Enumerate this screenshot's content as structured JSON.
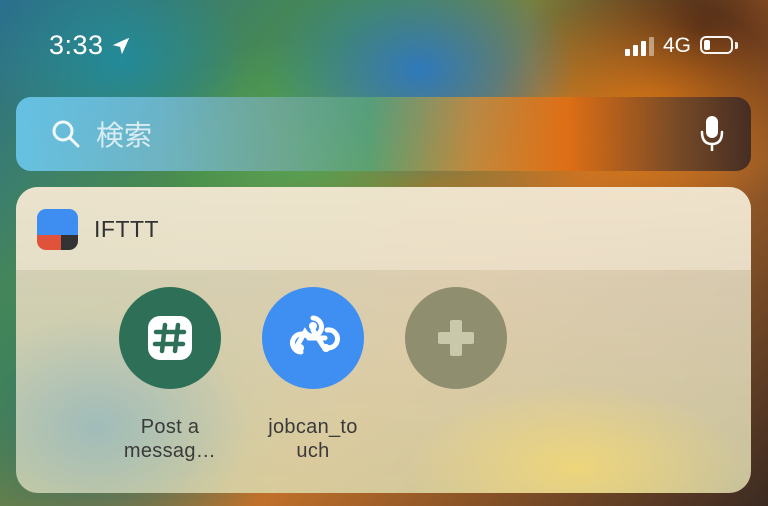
{
  "status": {
    "time": "3:33",
    "network": "4G"
  },
  "search": {
    "placeholder": "検索"
  },
  "widget": {
    "app_name": "IFTTT",
    "actions": [
      {
        "label_line1": "Post a",
        "label_line2": "messag…",
        "icon": "slack-icon",
        "color": "#2e6f57"
      },
      {
        "label_line1": "jobcan_to",
        "label_line2": "uch",
        "icon": "webhooks-icon",
        "color": "#3f8ff2"
      },
      {
        "label_line1": "",
        "label_line2": "",
        "icon": "add-icon",
        "color": "#8f8e6e"
      }
    ]
  }
}
